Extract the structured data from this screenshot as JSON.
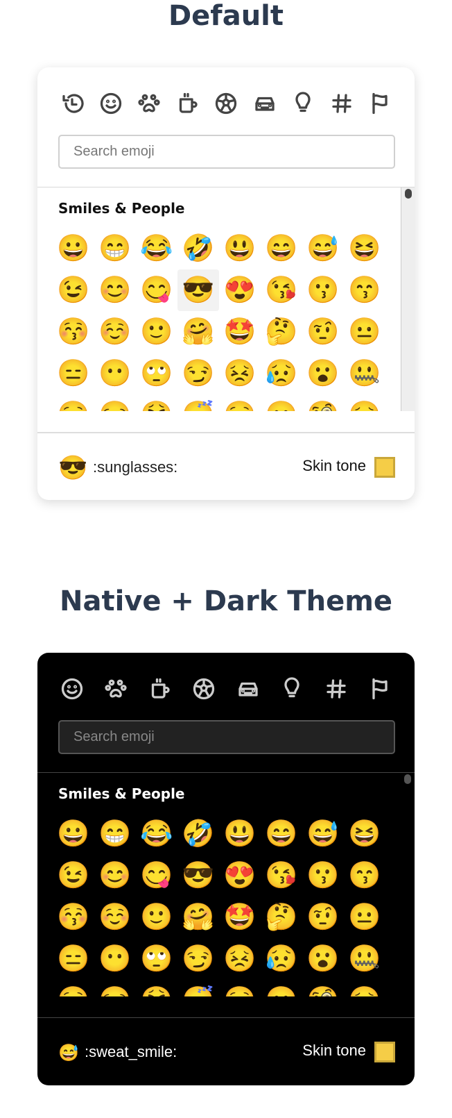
{
  "sections": [
    {
      "title": "Default",
      "theme": "light",
      "search_placeholder": "Search emoji",
      "category": "Smiles & People",
      "preview_emoji": "😎",
      "preview_name": ":sunglasses:",
      "skin_label": "Skin tone",
      "skin_color": "#f5cd47",
      "selected_index": 11,
      "nav": [
        "recent",
        "smileys",
        "animals",
        "food",
        "activity",
        "travel",
        "objects",
        "symbols",
        "flags"
      ]
    },
    {
      "title": "Native + Dark Theme",
      "theme": "dark",
      "search_placeholder": "Search emoji",
      "category": "Smiles & People",
      "preview_emoji": "😅",
      "preview_name": ":sweat_smile:",
      "skin_label": "Skin tone",
      "skin_color": "#f5cd47",
      "selected_index": -1,
      "nav": [
        "smileys",
        "animals",
        "food",
        "activity",
        "travel",
        "objects",
        "symbols",
        "flags"
      ]
    }
  ],
  "emojis": [
    "😀",
    "😁",
    "😂",
    "🤣",
    "😃",
    "😄",
    "😅",
    "😆",
    "😉",
    "😊",
    "😋",
    "😎",
    "😍",
    "😘",
    "😗",
    "😙",
    "😚",
    "☺️",
    "🙂",
    "🤗",
    "🤩",
    "🤔",
    "🤨",
    "😐",
    "😑",
    "😶",
    "🙄",
    "😏",
    "😣",
    "😥",
    "😮",
    "🤐",
    "😌",
    "😒",
    "😫",
    "😴",
    "😌",
    "😶",
    "🧐",
    "😣"
  ]
}
